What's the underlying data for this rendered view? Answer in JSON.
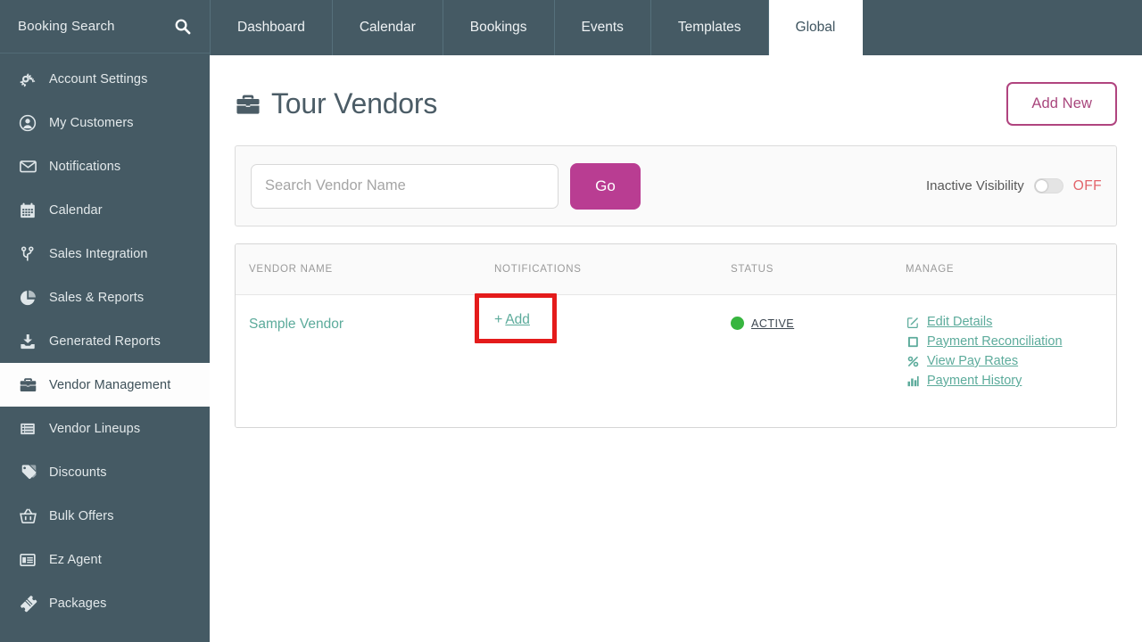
{
  "sidebar": {
    "header": {
      "title": "Booking Search",
      "search_icon": "search-icon"
    },
    "items": [
      {
        "label": "Account Settings",
        "icon": "gears-icon",
        "active": false
      },
      {
        "label": "My Customers",
        "icon": "user-circle-icon",
        "active": false
      },
      {
        "label": "Notifications",
        "icon": "envelope-icon",
        "active": false
      },
      {
        "label": "Calendar",
        "icon": "calendar-icon",
        "active": false
      },
      {
        "label": "Sales Integration",
        "icon": "branch-icon",
        "active": false
      },
      {
        "label": "Sales & Reports",
        "icon": "pie-chart-icon",
        "active": false
      },
      {
        "label": "Generated Reports",
        "icon": "download-icon",
        "active": false
      },
      {
        "label": "Vendor Management",
        "icon": "briefcase-icon",
        "active": true
      },
      {
        "label": "Vendor Lineups",
        "icon": "list-icon",
        "active": false
      },
      {
        "label": "Discounts",
        "icon": "tags-icon",
        "active": false
      },
      {
        "label": "Bulk Offers",
        "icon": "basket-icon",
        "active": false
      },
      {
        "label": "Ez Agent",
        "icon": "window-icon",
        "active": false
      },
      {
        "label": "Packages",
        "icon": "ticket-icon",
        "active": false
      }
    ]
  },
  "tabs": [
    {
      "label": "Dashboard",
      "active": false
    },
    {
      "label": "Calendar",
      "active": false
    },
    {
      "label": "Bookings",
      "active": false
    },
    {
      "label": "Events",
      "active": false
    },
    {
      "label": "Templates",
      "active": false
    },
    {
      "label": "Global",
      "active": true
    }
  ],
  "page": {
    "title": "Tour Vendors",
    "title_icon": "briefcase-icon",
    "add_new_label": "Add New"
  },
  "search": {
    "placeholder": "Search Vendor Name",
    "value": "",
    "go_label": "Go",
    "toggle_label": "Inactive Visibility",
    "toggle_state": "OFF",
    "toggle_on": false
  },
  "table": {
    "columns": [
      "VENDOR NAME",
      "NOTIFICATIONS",
      "STATUS",
      "MANAGE"
    ],
    "rows": [
      {
        "vendor_name": "Sample Vendor",
        "notifications": {
          "label": "Add",
          "plus": "+",
          "highlighted": true
        },
        "status": {
          "label": "ACTIVE",
          "color": "#37b53f"
        },
        "manage": [
          {
            "label": "Edit Details",
            "icon": "edit-icon"
          },
          {
            "label": "Payment Reconciliation",
            "icon": "book-icon"
          },
          {
            "label": "View Pay Rates",
            "icon": "percent-icon"
          },
          {
            "label": "Payment History",
            "icon": "bar-chart-icon"
          }
        ]
      }
    ]
  },
  "colors": {
    "sidebar_bg": "#455a64",
    "accent_magenta": "#b93d92",
    "accent_pink_outline": "#b0447f",
    "link_teal": "#5cab9b",
    "status_green": "#37b53f",
    "highlight_red": "#e41b1b",
    "toggle_off_text": "#e2646b"
  }
}
